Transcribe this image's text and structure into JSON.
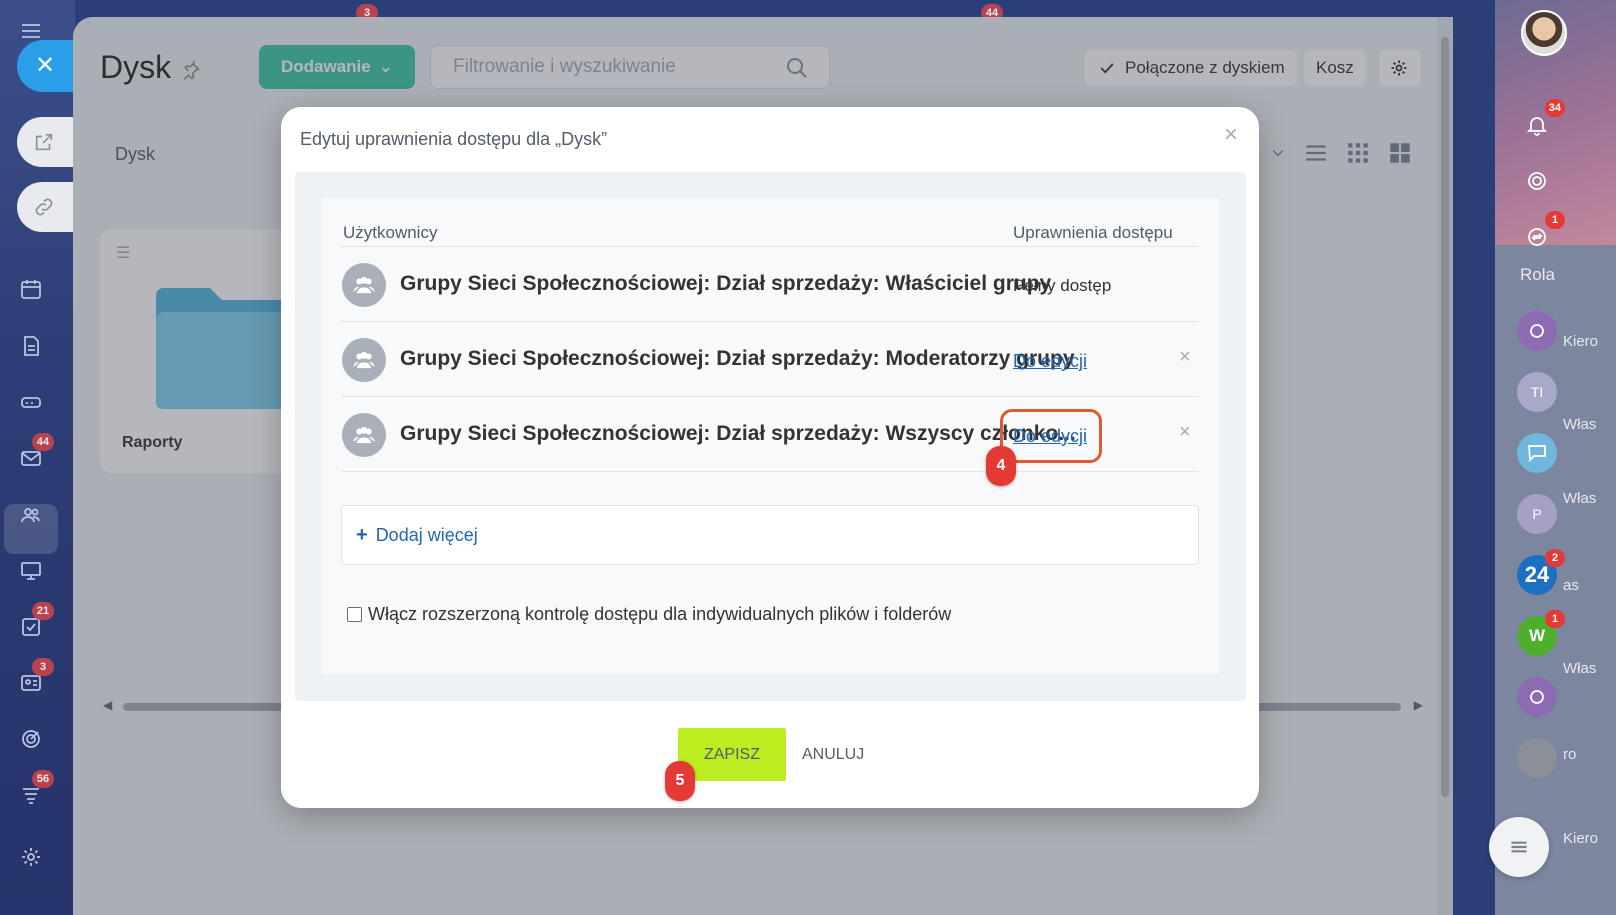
{
  "left_rail": {
    "badges": {
      "mail": "44",
      "tasks": "21",
      "contacts": "3",
      "feed": "56"
    }
  },
  "top_counters": {
    "a": "3",
    "b": "44"
  },
  "page": {
    "title": "Dysk",
    "add_button": "Dodawanie",
    "search_placeholder": "Filtrowanie i wyszukiwanie",
    "connected_label": "Połączone z dyskiem",
    "trash_label": "Kosz",
    "breadcrumb": "Dysk",
    "files": [
      {
        "name": "Raporty"
      }
    ]
  },
  "modal": {
    "title": "Edytuj uprawnienia dostępu dla „Dysk”",
    "close_glyph": "×",
    "col_users": "Użytkownicy",
    "col_permissions": "Uprawnienia dostępu",
    "rows": [
      {
        "name": "Grupy Sieci Społecznościowej: Dział sprzedaży: Właściciel grupy",
        "permission": "Pełny dostęp",
        "removable": false
      },
      {
        "name": "Grupy Sieci Społecznościowej: Dział sprzedaży: Moderatorzy grupy",
        "permission": "Do edycji",
        "removable": true
      },
      {
        "name": "Grupy Sieci Społecznościowej: Dział sprzedaży: Wszyscy członko...",
        "permission": "Do edycji",
        "removable": true
      }
    ],
    "remove_glyph": "×",
    "add_more": "Dodaj więcej",
    "add_more_plus": "+",
    "extended_control_label": "Włącz rozszerzoną kontrolę dostępu dla indywidualnych plików i folderów",
    "extended_control_checked": false,
    "save_button": "ZAPISZ",
    "cancel_button": "ANULUJ"
  },
  "annotations": {
    "step4": "4",
    "step5": "5"
  },
  "right_rail": {
    "badges": {
      "notifications": "34",
      "sync": "1",
      "b24": "2",
      "w": "1"
    },
    "labels": {
      "rola": "Rola",
      "wlas1": "Włas",
      "wlas2": "Włas",
      "wlas3": "Włas",
      "kiero1": "Kiero",
      "kiero2": "Kiero",
      "pas": "as",
      "ro": "ro"
    },
    "avatar_letters": {
      "ti": "TI",
      "p": "P",
      "w": "W",
      "b24": "24"
    }
  },
  "colors": {
    "accent_green": "#3bc8a2",
    "save_green": "#bbed21",
    "link_blue": "#2067b0",
    "annotation_red": "#e53935",
    "callout_orange": "#e05a2b"
  }
}
